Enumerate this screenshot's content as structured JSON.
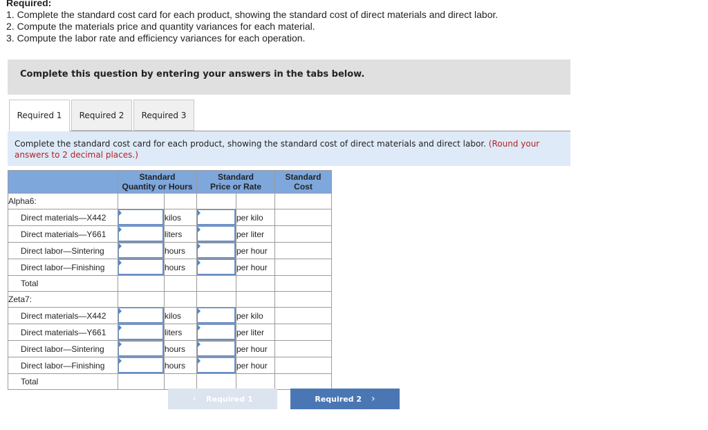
{
  "required": {
    "title": "Required:",
    "items": [
      "1. Complete the standard cost card for each product, showing the standard cost of direct materials and direct labor.",
      "2. Compute the materials price and quantity variances for each material.",
      "3. Compute the labor rate and efficiency variances for each operation."
    ]
  },
  "instruction_box": "Complete this question by entering your answers in the tabs below.",
  "tabs": [
    {
      "label": "Required 1",
      "active": true
    },
    {
      "label": "Required 2",
      "active": false
    },
    {
      "label": "Required 3",
      "active": false
    }
  ],
  "prompt": {
    "text": "Complete the standard cost card for each product, showing the standard cost of direct materials and direct labor.",
    "hint": "(Round your answers to 2 decimal places.)"
  },
  "table": {
    "headers": {
      "qty": [
        "Standard",
        "Quantity or Hours"
      ],
      "price": [
        "Standard",
        "Price or Rate"
      ],
      "cost": [
        "Standard",
        "Cost"
      ]
    },
    "products": [
      {
        "name": "Alpha6:",
        "rows": [
          {
            "label": "Direct materials—X442",
            "qty_unit": "kilos",
            "price_unit": "per kilo",
            "qty": "",
            "price": ""
          },
          {
            "label": "Direct materials—Y661",
            "qty_unit": "liters",
            "price_unit": "per liter",
            "qty": "",
            "price": ""
          },
          {
            "label": "Direct labor—Sintering",
            "qty_unit": "hours",
            "price_unit": "per hour",
            "qty": "",
            "price": ""
          },
          {
            "label": "Direct labor—Finishing",
            "qty_unit": "hours",
            "price_unit": "per hour",
            "qty": "",
            "price": ""
          }
        ],
        "total_label": "Total"
      },
      {
        "name": "Zeta7:",
        "rows": [
          {
            "label": "Direct materials—X442",
            "qty_unit": "kilos",
            "price_unit": "per kilo",
            "qty": "",
            "price": ""
          },
          {
            "label": "Direct materials—Y661",
            "qty_unit": "liters",
            "price_unit": "per liter",
            "qty": "",
            "price": ""
          },
          {
            "label": "Direct labor—Sintering",
            "qty_unit": "hours",
            "price_unit": "per hour",
            "qty": "",
            "price": ""
          },
          {
            "label": "Direct labor—Finishing",
            "qty_unit": "hours",
            "price_unit": "per hour",
            "qty": "",
            "price": ""
          }
        ],
        "total_label": "Total"
      }
    ]
  },
  "nav": {
    "prev_label": "Required 1",
    "next_label": "Required 2",
    "prev_icon": "chevron-left-icon",
    "next_icon": "chevron-right-icon",
    "prev_enabled": false,
    "next_enabled": true
  },
  "colors": {
    "header_blue": "#7ea7dc",
    "prompt_bg": "#deeaf8",
    "hint_red": "#b22222",
    "next_button": "#4a77b4",
    "prev_button_disabled": "#dbe4ef"
  }
}
